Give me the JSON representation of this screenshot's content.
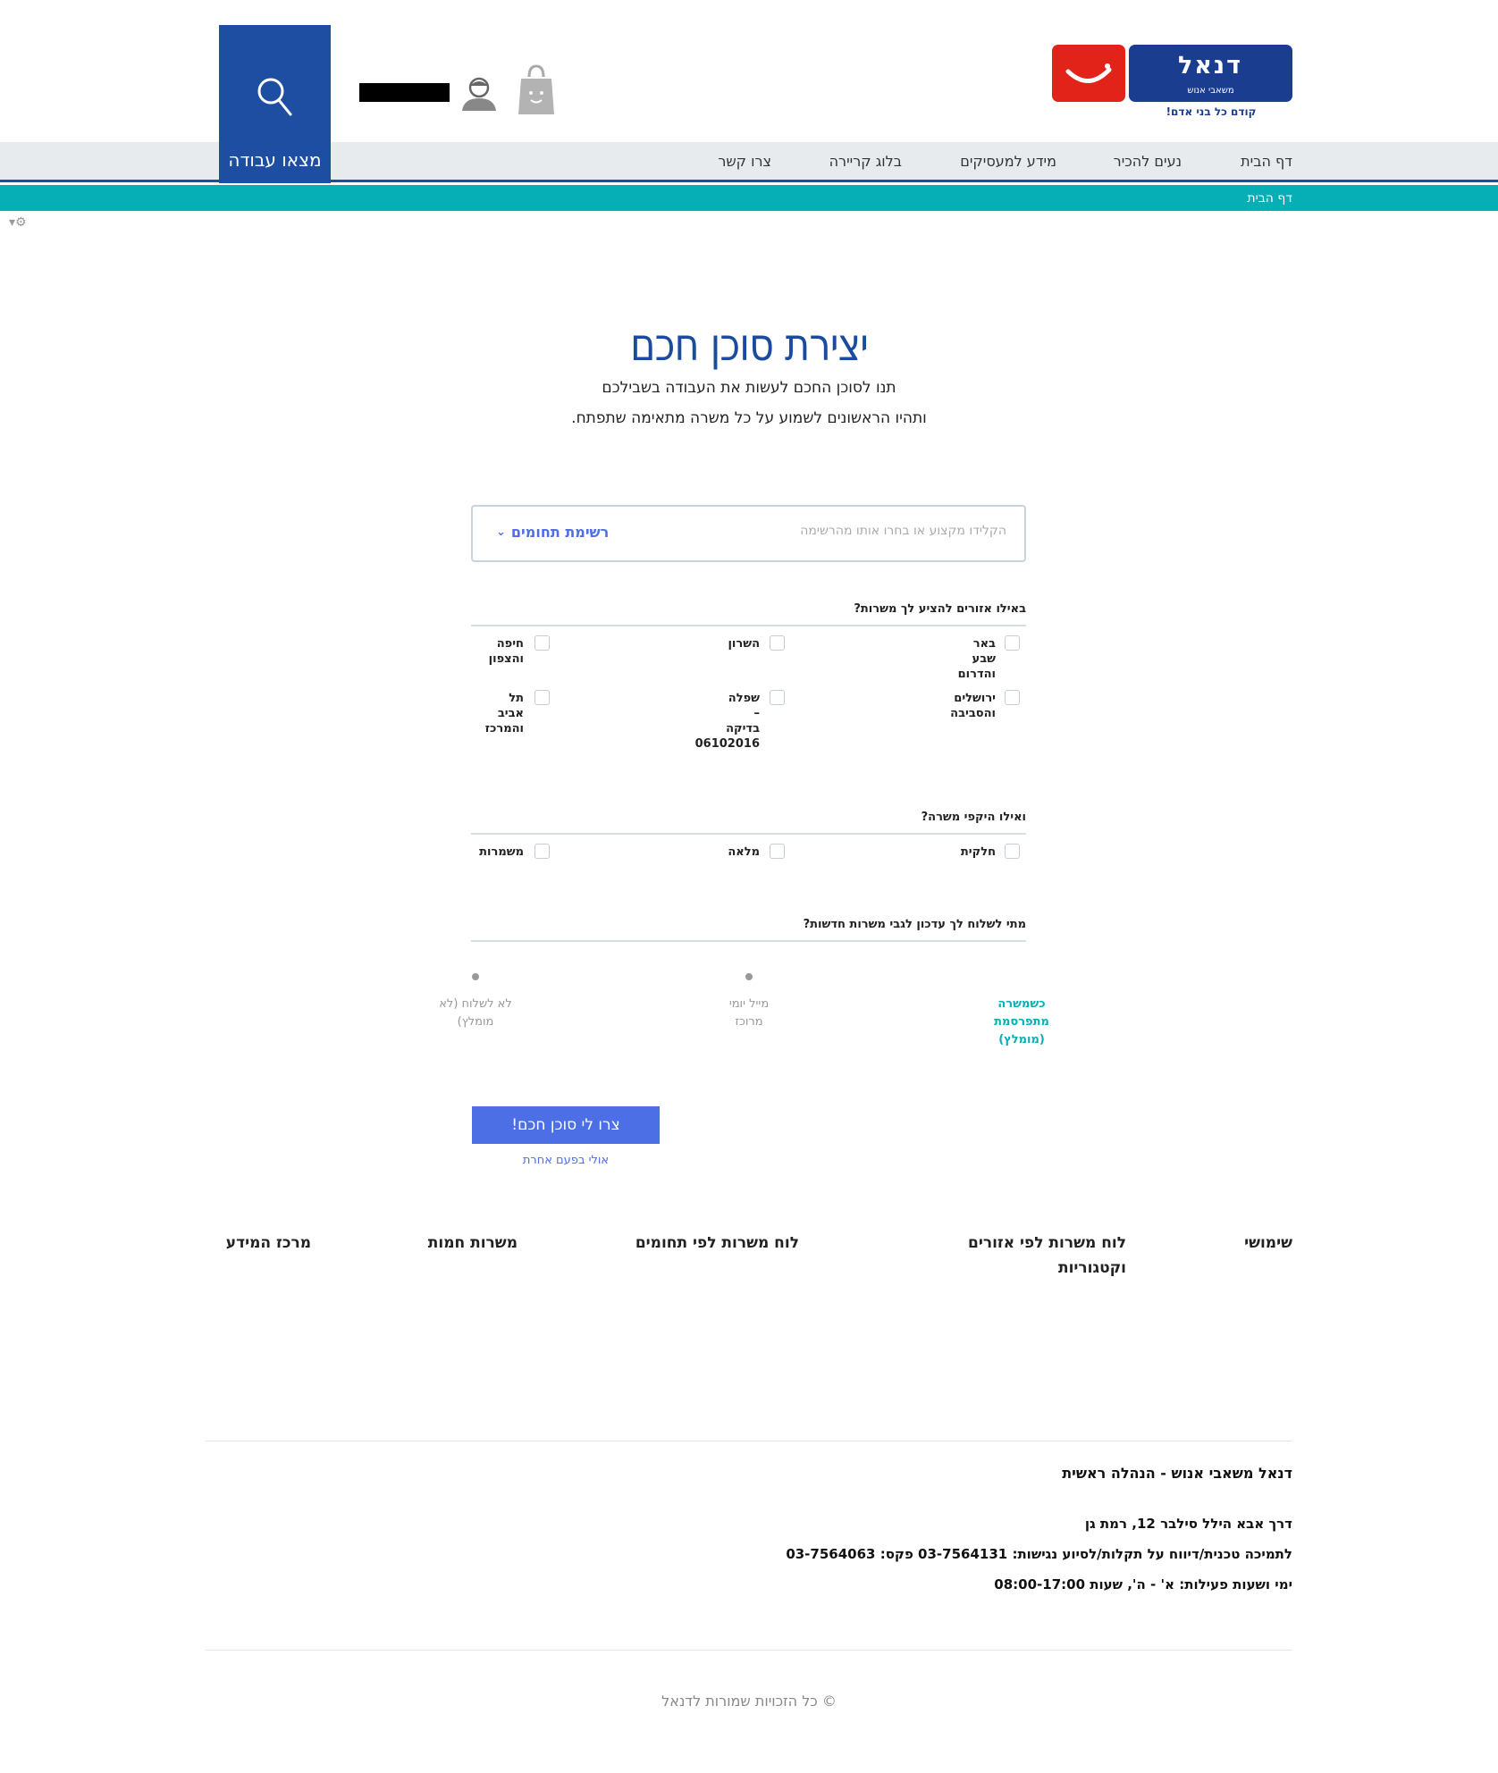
{
  "header": {
    "logo_name": "דנאל",
    "logo_sub": "משאבי אנוש",
    "logo_tagline": "קודם כל בני אדם!",
    "search_label": "מצאו עבודה",
    "user_name": ""
  },
  "nav": {
    "items": [
      "דף הבית",
      "נעים להכיר",
      "מידע למעסיקים",
      "בלוג קריירה",
      "צרו קשר"
    ]
  },
  "breadcrumb": "דף הבית",
  "main": {
    "title": "יצירת סוכן חכם",
    "subtitle_line1": "תנו לסוכן החכם לעשות את העבודה בשבילכם",
    "subtitle_line2": "ותהיו הראשונים לשמוע על כל משרה מתאימה שתפתח.",
    "field_placeholder": "הקלידו מקצוע או בחרו אותו מהרשימה",
    "field_toggle": "רשימת תחומים",
    "regions_question": "באילו אזורים להציע לך משרות?",
    "regions": [
      "באר\nשבע\nוהדרום",
      "השרון",
      "חיפה\nוהצפון",
      "ירושלים\nוהסביבה",
      "שפלה\n–\nבדיקה\n06102016",
      "תל\nאביב\nוהמרכז"
    ],
    "scope_question": "ואילו היקפי משרה?",
    "scopes": [
      "חלקית",
      "מלאה",
      "משמרות"
    ],
    "update_question": "מתי לשלוח לך עדכון לגבי משרות חדשות?",
    "update_options": [
      "כשמשרה\nמתפרסמת\n(מומלץ)",
      "מייל יומי\nמרוכז",
      "לא לשלוח (לא\nמומלץ)"
    ],
    "submit_label": "צרו לי סוכן חכם!",
    "later_label": "אולי בפעם אחרת"
  },
  "footer": {
    "links": [
      "שימושי",
      "לוח משרות לפי אזורים\nוקטגוריות",
      "לוח משרות לפי תחומים",
      "משרות חמות",
      "מרכז המידע"
    ],
    "company": "דנאל משאבי אנוש - הנהלה ראשית",
    "address": "דרך אבא הילל סילבר 12, רמת גן",
    "support": "לתמיכה טכנית/דיווח על תקלות/לסיוע נגישות: 03-7564131 פקס: 03-7564063",
    "hours": "ימי ושעות פעילות: א' - ה', שעות 08:00-17:00",
    "copyright": "© כל הזכויות שמורות לדנאל"
  },
  "colors": {
    "brand_blue": "#1d4ea2",
    "teal": "#06afb5",
    "accent_blue": "#4d6fe6",
    "logo_red": "#e2231a"
  }
}
